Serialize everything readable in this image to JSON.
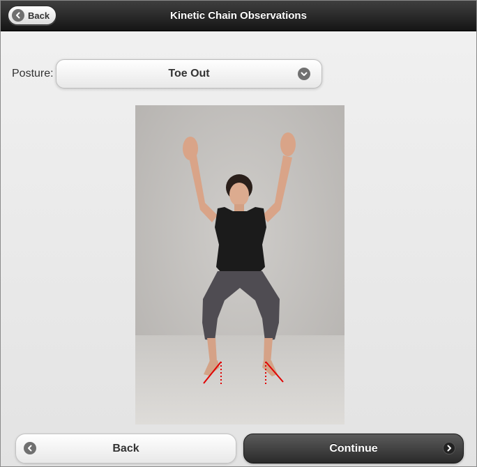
{
  "header": {
    "title": "Kinetic Chain Observations",
    "back_label": "Back",
    "back_icon": "chevron-left-icon"
  },
  "posture": {
    "label": "Posture:",
    "selected": "Toe Out",
    "dropdown_icon": "chevron-down-icon"
  },
  "footer": {
    "back_label": "Back",
    "back_icon": "chevron-left-icon",
    "continue_label": "Continue",
    "continue_icon": "chevron-right-icon"
  },
  "colors": {
    "header_bg": "#1f1f1f",
    "annotation_line": "#e00000"
  }
}
